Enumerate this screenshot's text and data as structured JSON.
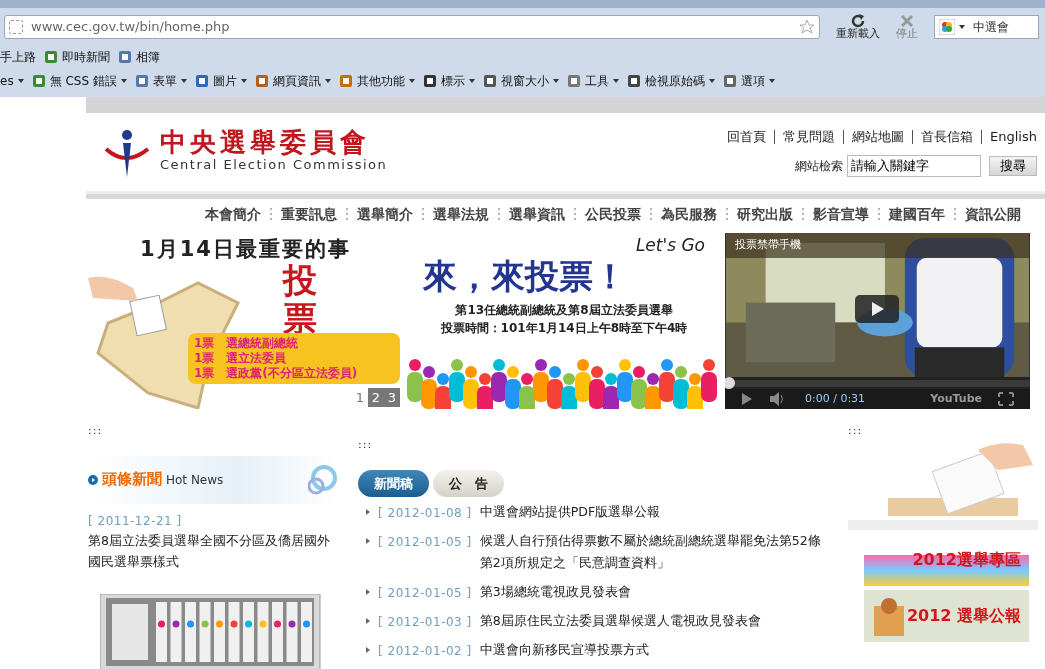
{
  "browser": {
    "url": "www.cec.gov.tw/bin/home.php",
    "reload_label": "重新載入",
    "stop_label": "停止",
    "search_value": "中選會",
    "bookmarks": [
      {
        "label": "手上路",
        "icon": false
      },
      {
        "label": "即時新聞",
        "icon": true
      },
      {
        "label": "相簿",
        "icon": true
      }
    ],
    "toolbar": [
      {
        "label": "es",
        "icon": false
      },
      {
        "label": "無 CSS 錯誤",
        "icon": true
      },
      {
        "label": "表單",
        "icon": true
      },
      {
        "label": "圖片",
        "icon": true
      },
      {
        "label": "網頁資訊",
        "icon": true
      },
      {
        "label": "其他功能",
        "icon": true
      },
      {
        "label": "標示",
        "icon": true
      },
      {
        "label": "視窗大小",
        "icon": true
      },
      {
        "label": "工具",
        "icon": true
      },
      {
        "label": "檢視原始碼",
        "icon": true
      },
      {
        "label": "選項",
        "icon": true
      }
    ]
  },
  "site": {
    "logo_title": "中央選舉委員會",
    "logo_subtitle": "Central Election Commission",
    "top_links": [
      "回首頁",
      "常見問題",
      "網站地圖",
      "首長信箱",
      "English"
    ],
    "search_label": "網站檢索",
    "search_value": "請輸入關鍵字",
    "search_button": "搜尋"
  },
  "nav": [
    "本會簡介",
    "重要訊息",
    "選舉簡介",
    "選舉法規",
    "選舉資訊",
    "公民投票",
    "為民服務",
    "研究出版",
    "影音宣導",
    "建國百年",
    "資訊公開"
  ],
  "banner": {
    "headline": "1月14日最重要的事",
    "vote_chars": [
      "投",
      "票"
    ],
    "ballot_lines": [
      "1票　選總統副總統",
      "1票　選立法委員",
      "1票　選政黨(不分區立法委員)"
    ],
    "pager": [
      {
        "label": "1",
        "selected": true
      },
      {
        "label": "2",
        "selected": false
      },
      {
        "label": "3",
        "selected": false
      }
    ]
  },
  "promo": {
    "lets_go": "Let's Go",
    "title": "來，來投票！",
    "subtitle": "第13任總統副總統及第8屆立法委員選舉",
    "time": "投票時間：101年1月14日上午8時至下午4時"
  },
  "video": {
    "title": "投票禁帶手機",
    "current": "0:00",
    "duration": "/ 0:31",
    "level": 0,
    "logo": "YouTube"
  },
  "section_markers": [
    ":::",
    ":::",
    ":::"
  ],
  "hot_news": {
    "heading": "頭條新聞",
    "heading_en": "Hot News",
    "date": "[ 2011-12-21 ]",
    "title": "第8屆立法委員選舉全國不分區及僑居國外國民選舉票樣式"
  },
  "tabs": [
    {
      "label": "新聞稿",
      "selected": true
    },
    {
      "label": "公　告",
      "selected": false
    }
  ],
  "news": [
    {
      "date": "[ 2012-01-08 ]",
      "title": "中選會網站提供PDF版選舉公報"
    },
    {
      "date": "[ 2012-01-05 ]",
      "title": "候選人自行預估得票數不屬於總統副總統選舉罷免法第52條第2項所規定之「民意調查資料」"
    },
    {
      "date": "[ 2012-01-05 ]",
      "title": "第3場總統電視政見發表會"
    },
    {
      "date": "[ 2012-01-03 ]",
      "title": "第8屆原住民立法委員選舉候選人電視政見發表會"
    },
    {
      "date": "[ 2012-01-02 ]",
      "title": "中選會向新移民宣導投票方式"
    }
  ],
  "side_banners": [
    {
      "kind": "crowd",
      "title": "2012選舉專區"
    },
    {
      "kind": "paper",
      "title": "2012 選舉公報"
    }
  ]
}
